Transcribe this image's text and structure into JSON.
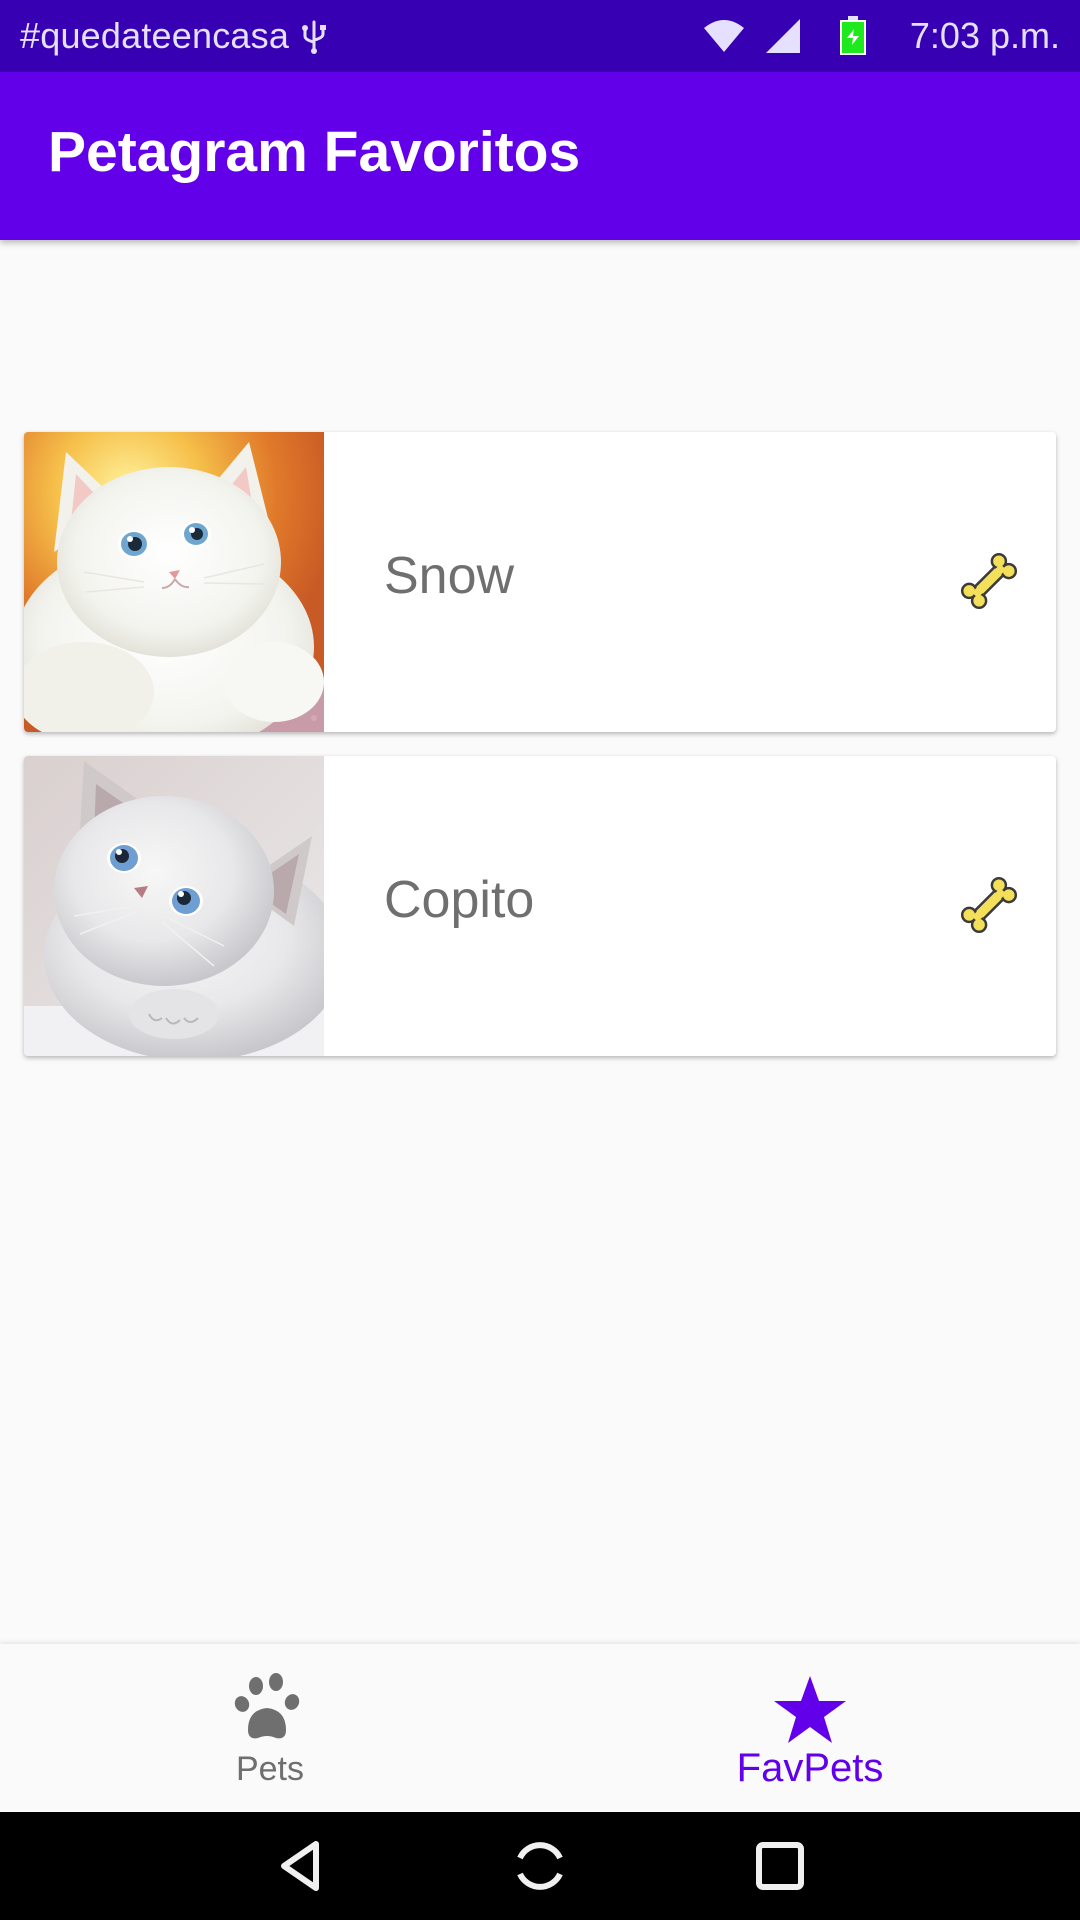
{
  "status_bar": {
    "left_text": "#quedateencasa",
    "time": "7:03 p.m.",
    "icons": [
      "usb-icon",
      "wifi-icon",
      "signal-icon",
      "battery-charging-icon"
    ]
  },
  "app_bar": {
    "title": "Petagram Favoritos"
  },
  "pets": [
    {
      "name": "Snow",
      "photo": "white-kitten-photo",
      "action_icon": "bone-icon"
    },
    {
      "name": "Copito",
      "photo": "fluffy-kitten-photo",
      "action_icon": "bone-icon"
    }
  ],
  "bottom_nav": {
    "items": [
      {
        "label": "Pets",
        "icon": "paw-icon",
        "selected": false
      },
      {
        "label": "FavPets",
        "icon": "star-icon",
        "selected": true
      }
    ]
  },
  "system_nav": {
    "buttons": [
      "back-icon",
      "home-icon",
      "recents-icon"
    ]
  },
  "colors": {
    "status_bar": "#3700b3",
    "app_bar": "#6200ea",
    "accent": "#6200ea",
    "background": "#fafafa",
    "bone_fill": "#f4df5a"
  }
}
